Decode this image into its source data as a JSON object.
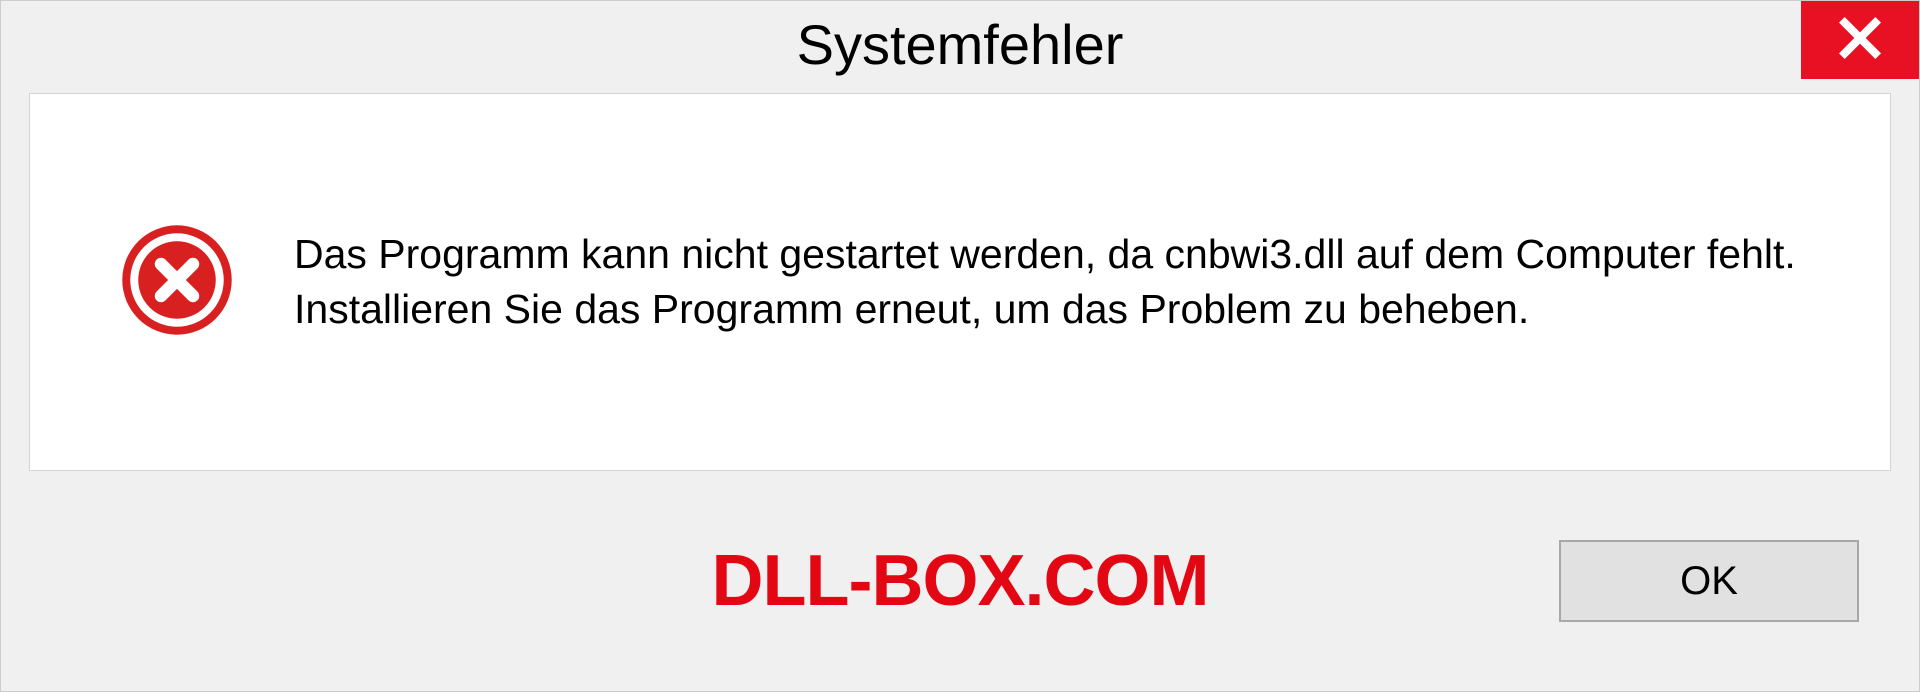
{
  "dialog": {
    "title": "Systemfehler",
    "message": "Das Programm kann nicht gestartet werden, da cnbwi3.dll auf dem Computer fehlt. Installieren Sie das Programm erneut, um das Problem zu beheben.",
    "ok_label": "OK"
  },
  "brand": "DLL-BOX.COM",
  "colors": {
    "close_bg": "#e81123",
    "error_icon": "#d92020",
    "brand_color": "#e30613"
  }
}
